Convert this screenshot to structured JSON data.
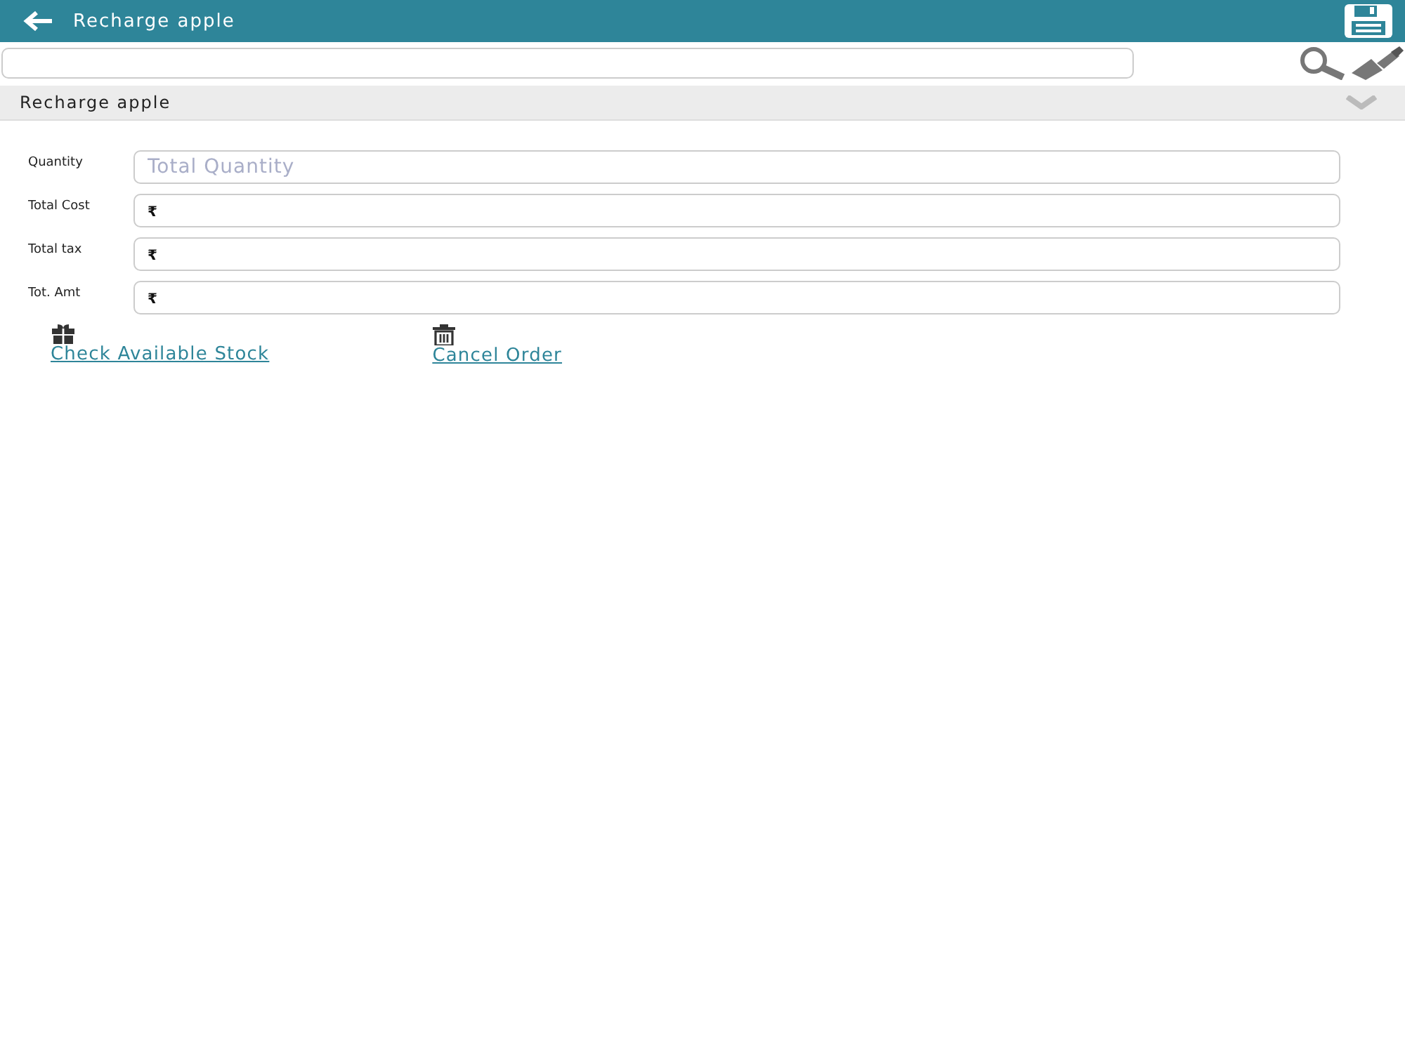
{
  "header": {
    "title": "Recharge apple"
  },
  "section": {
    "title": "Recharge apple"
  },
  "fields": [
    {
      "label": "Quantity",
      "kind": "plain",
      "placeholder": "Total Quantity"
    },
    {
      "label": "Total Cost",
      "kind": "currency",
      "prefix": "₹"
    },
    {
      "label": "Total tax",
      "kind": "currency",
      "prefix": "₹"
    },
    {
      "label": "Tot. Amt",
      "kind": "currency",
      "prefix": "₹"
    }
  ],
  "actions": [
    {
      "label": "Check Available Stock",
      "kind": "gift"
    },
    {
      "label": "Cancel Order",
      "kind": "trash"
    }
  ]
}
